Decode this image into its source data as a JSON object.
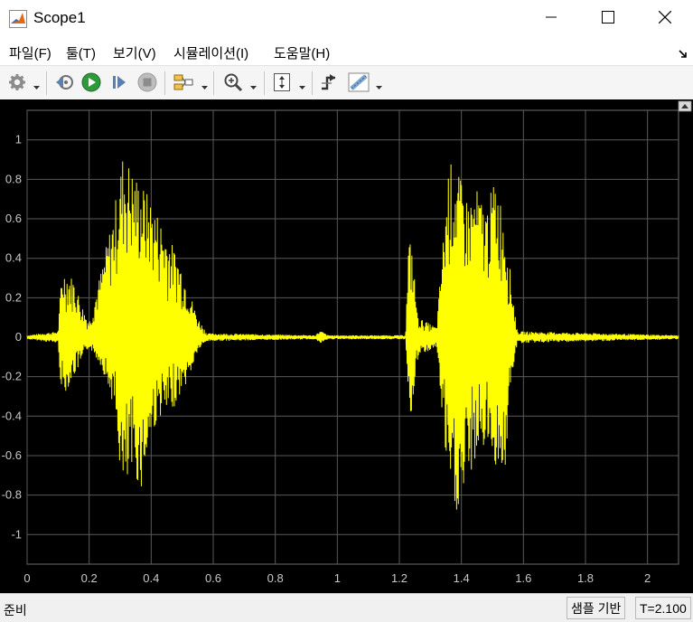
{
  "window": {
    "title": "Scope1",
    "icons": {
      "app": "matlab-icon",
      "minimize": "minimize-icon",
      "maximize": "maximize-icon",
      "close": "close-icon"
    }
  },
  "menu": {
    "items": [
      {
        "label": "파일(F)"
      },
      {
        "label": "툴(T)"
      },
      {
        "label": "보기(V)"
      },
      {
        "label": "시뮬레이션(I)"
      },
      {
        "label": "도움말(H)"
      }
    ],
    "undock_icon": "undock-arrow-icon"
  },
  "toolbar": {
    "icons": [
      "settings-gear-icon",
      "step-back-icon",
      "run-icon",
      "step-forward-icon",
      "stop-icon",
      "highlight-block-icon",
      "zoom-in-icon",
      "fit-axes-icon",
      "triggers-icon",
      "measurements-icon"
    ]
  },
  "colors": {
    "signal": "#ffff00",
    "plot_background": "#000000",
    "grid": "#5a5a5a",
    "axis_text": "#c8c8c8"
  },
  "chart_data": {
    "type": "line",
    "xlim": [
      0,
      2.1
    ],
    "ylim": [
      -1.15,
      1.15
    ],
    "x_ticks": [
      "0",
      "0.2",
      "0.4",
      "0.6",
      "0.8",
      "1",
      "1.2",
      "1.4",
      "1.6",
      "1.8",
      "2"
    ],
    "y_ticks": [
      "1",
      "0.8",
      "0.6",
      "0.4",
      "0.2",
      "0",
      "-0.2",
      "-0.4",
      "-0.6",
      "-0.8",
      "-1"
    ],
    "grid": true,
    "series": [
      {
        "color": "#ffff00",
        "envelope": [
          {
            "x": 0.0,
            "max": 0.01,
            "min": -0.01
          },
          {
            "x": 0.1,
            "max": 0.03,
            "min": -0.03
          },
          {
            "x": 0.11,
            "max": 0.3,
            "min": -0.28
          },
          {
            "x": 0.12,
            "max": 0.34,
            "min": -0.29
          },
          {
            "x": 0.15,
            "max": 0.3,
            "min": -0.2
          },
          {
            "x": 0.18,
            "max": 0.15,
            "min": -0.12
          },
          {
            "x": 0.2,
            "max": 0.08,
            "min": -0.05
          },
          {
            "x": 0.24,
            "max": 0.35,
            "min": -0.15
          },
          {
            "x": 0.28,
            "max": 0.65,
            "min": -0.35
          },
          {
            "x": 0.31,
            "max": 0.95,
            "min": -0.84
          },
          {
            "x": 0.34,
            "max": 0.85,
            "min": -0.7
          },
          {
            "x": 0.37,
            "max": 0.78,
            "min": -0.77
          },
          {
            "x": 0.4,
            "max": 0.7,
            "min": -0.5
          },
          {
            "x": 0.43,
            "max": 0.6,
            "min": -0.4
          },
          {
            "x": 0.46,
            "max": 0.5,
            "min": -0.4
          },
          {
            "x": 0.49,
            "max": 0.4,
            "min": -0.3
          },
          {
            "x": 0.52,
            "max": 0.25,
            "min": -0.22
          },
          {
            "x": 0.55,
            "max": 0.1,
            "min": -0.07
          },
          {
            "x": 0.58,
            "max": 0.02,
            "min": -0.02
          },
          {
            "x": 0.93,
            "max": 0.01,
            "min": -0.01
          },
          {
            "x": 0.94,
            "max": 0.03,
            "min": -0.03
          },
          {
            "x": 0.95,
            "max": 0.03,
            "min": -0.03
          },
          {
            "x": 0.97,
            "max": 0.01,
            "min": -0.01
          },
          {
            "x": 1.22,
            "max": 0.01,
            "min": -0.01
          },
          {
            "x": 1.23,
            "max": 0.5,
            "min": -0.3
          },
          {
            "x": 1.24,
            "max": 0.47,
            "min": -0.43
          },
          {
            "x": 1.26,
            "max": 0.1,
            "min": -0.1
          },
          {
            "x": 1.32,
            "max": 0.05,
            "min": -0.05
          },
          {
            "x": 1.36,
            "max": 0.9,
            "min": -0.83
          },
          {
            "x": 1.39,
            "max": 0.83,
            "min": -0.91
          },
          {
            "x": 1.42,
            "max": 0.7,
            "min": -0.75
          },
          {
            "x": 1.45,
            "max": 0.75,
            "min": -0.6
          },
          {
            "x": 1.48,
            "max": 0.65,
            "min": -0.55
          },
          {
            "x": 1.51,
            "max": 0.82,
            "min": -0.65
          },
          {
            "x": 1.54,
            "max": 0.6,
            "min": -0.7
          },
          {
            "x": 1.56,
            "max": 0.3,
            "min": -0.25
          },
          {
            "x": 1.58,
            "max": 0.03,
            "min": -0.03
          },
          {
            "x": 2.1,
            "max": 0.01,
            "min": -0.01
          }
        ]
      }
    ]
  },
  "status": {
    "left": "준비",
    "sample_based": "샘플 기반",
    "time": "T=2.100"
  }
}
